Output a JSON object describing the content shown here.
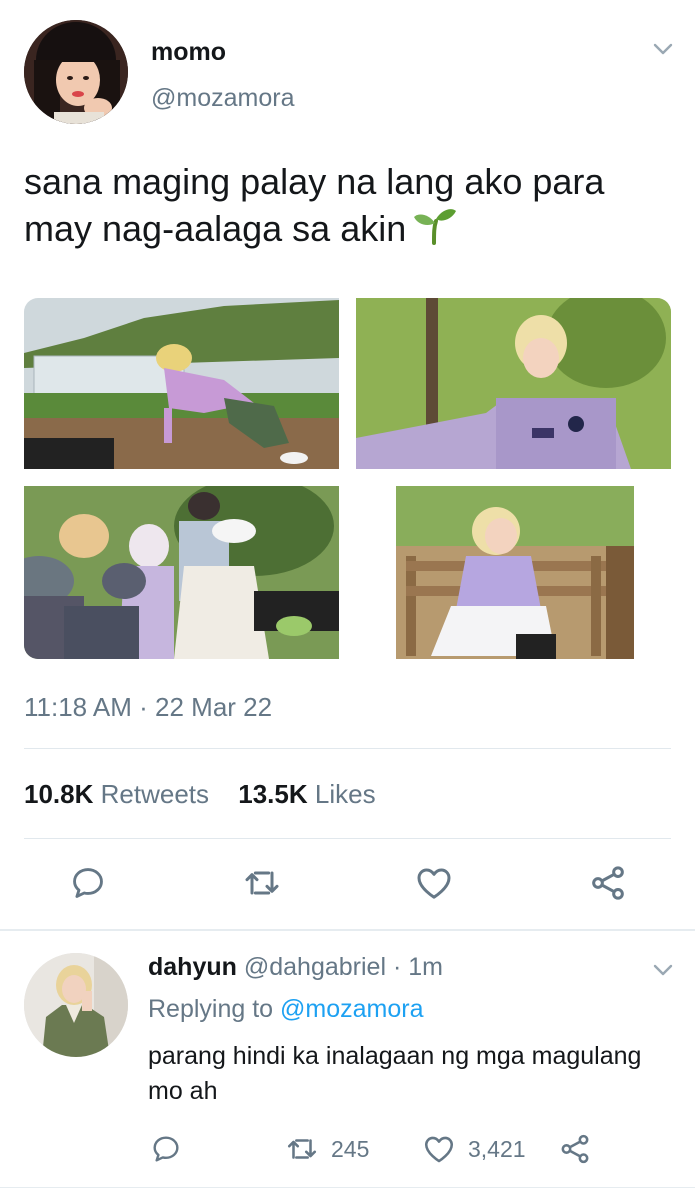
{
  "tweet": {
    "display_name": "momo",
    "handle": "@mozamora",
    "text": "sana maging palay na lang ako para may nag-aalaga sa akin",
    "emoji": "seedling",
    "timestamp": "11:18 AM · 22 Mar 22",
    "retweet_count": "10.8K",
    "retweet_label": "Retweets",
    "like_count": "13.5K",
    "like_label": "Likes",
    "icons": [
      "chevron-down-icon",
      "reply-icon",
      "retweet-icon",
      "heart-icon",
      "share-icon"
    ]
  },
  "reply": {
    "display_name": "dahyun",
    "handle": "@dahgabriel",
    "time": "· 1m",
    "replying_prefix": "Replying to",
    "replying_to": "@mozamora",
    "text": "parang hindi ka inalagaan ng mga magulang mo ah",
    "retweet_count": "245",
    "like_count": "3,421"
  },
  "colors": {
    "text": "#14171a",
    "secondary": "#657786",
    "link": "#1da1f2",
    "divider": "#e1e8ed"
  }
}
